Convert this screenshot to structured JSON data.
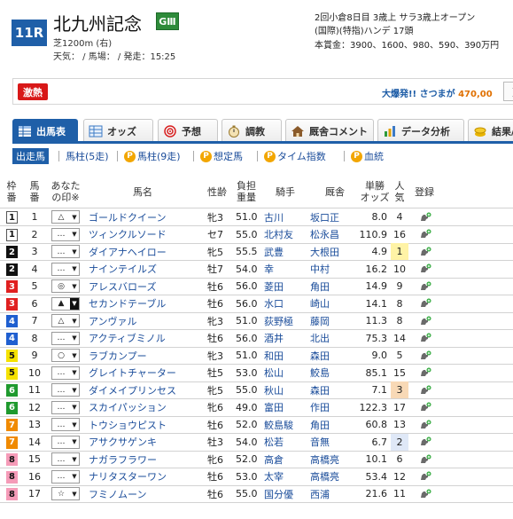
{
  "race": {
    "number": "11R",
    "title": "北九州記念",
    "grade": "GⅢ",
    "course": "芝1200m (右)",
    "conditions": "天気： / 馬場： / 発走：15:25",
    "info1": "2回小倉8日目 3歳上 サラ3歳上オープン",
    "info2": "(国際)(特指)ハンデ 17頭",
    "info3": "本賞金：3900、1600、980、590、390万円"
  },
  "promo": {
    "badge": "激熱",
    "text": "大爆発!! さつまが",
    "price": "470,00",
    "next": "＞"
  },
  "tabs": [
    {
      "label": "出馬表",
      "icon": "table-icon"
    },
    {
      "label": "オッズ",
      "icon": "chart-icon"
    },
    {
      "label": "予想",
      "icon": "target-icon"
    },
    {
      "label": "調教",
      "icon": "stopwatch-icon"
    },
    {
      "label": "厩舎コメント",
      "icon": "house-icon"
    },
    {
      "label": "データ分析",
      "icon": "bar-chart-icon"
    },
    {
      "label": "結果/",
      "icon": "coin-icon"
    }
  ],
  "subnav": [
    {
      "label": "出走馬",
      "premium": false
    },
    {
      "label": "馬柱(5走)",
      "premium": false
    },
    {
      "label": "馬柱(9走)",
      "premium": true
    },
    {
      "label": "想定馬",
      "premium": true
    },
    {
      "label": "タイム指数",
      "premium": true
    },
    {
      "label": "血統",
      "premium": true
    }
  ],
  "headers": {
    "waku": "枠\n番",
    "uma": "馬\n番",
    "mark": "あなた\nの印※",
    "name": "馬名",
    "sex": "性齢",
    "weight": "負担\n重量",
    "jockey": "騎手",
    "trainer": "厩舎",
    "odds": "単勝\nオッズ",
    "pop": "人\n気",
    "reg": "登録"
  },
  "colors": {
    "accent": "#1f5fa8",
    "waku": [
      "#ffffff",
      "#111111",
      "#e02020",
      "#1f5fd0",
      "#f5e200",
      "#1f9a2e",
      "#f08a00",
      "#f59bb8"
    ],
    "wakuText": [
      "#111111",
      "#ffffff",
      "#ffffff",
      "#ffffff",
      "#111111",
      "#ffffff",
      "#ffffff",
      "#111111"
    ]
  },
  "rows": [
    {
      "waku": "1",
      "uma": "1",
      "mark": "△",
      "name": "ゴールドクイーン",
      "sex": "牝3",
      "weight": "51.0",
      "jockey": "古川",
      "trainer": "坂口正",
      "odds": "8.0",
      "pop": "4"
    },
    {
      "waku": "1",
      "uma": "2",
      "mark": "…",
      "name": "ツィンクルソード",
      "sex": "セ7",
      "weight": "55.0",
      "jockey": "北村友",
      "trainer": "松永昌",
      "odds": "110.9",
      "pop": "16"
    },
    {
      "waku": "2",
      "uma": "3",
      "mark": "…",
      "name": "ダイアナヘイロー",
      "sex": "牝5",
      "weight": "55.5",
      "jockey": "武豊",
      "trainer": "大根田",
      "odds": "4.9",
      "pop": "1"
    },
    {
      "waku": "2",
      "uma": "4",
      "mark": "…",
      "name": "ナインテイルズ",
      "sex": "牡7",
      "weight": "54.0",
      "jockey": "幸",
      "trainer": "中村",
      "odds": "16.2",
      "pop": "10"
    },
    {
      "waku": "3",
      "uma": "5",
      "mark": "◎",
      "name": "アレスバローズ",
      "sex": "牡6",
      "weight": "56.0",
      "jockey": "菱田",
      "trainer": "角田",
      "odds": "14.9",
      "pop": "9"
    },
    {
      "waku": "3",
      "uma": "6",
      "mark": "▲",
      "name": "セカンドテーブル",
      "sex": "牡6",
      "weight": "56.0",
      "jockey": "水口",
      "trainer": "崎山",
      "odds": "14.1",
      "pop": "8"
    },
    {
      "waku": "4",
      "uma": "7",
      "mark": "△",
      "name": "アンヴァル",
      "sex": "牝3",
      "weight": "51.0",
      "jockey": "荻野極",
      "trainer": "藤岡",
      "odds": "11.3",
      "pop": "8"
    },
    {
      "waku": "4",
      "uma": "8",
      "mark": "…",
      "name": "アクティブミノル",
      "sex": "牡6",
      "weight": "56.0",
      "jockey": "酒井",
      "trainer": "北出",
      "odds": "75.3",
      "pop": "14"
    },
    {
      "waku": "5",
      "uma": "9",
      "mark": "○",
      "name": "ラブカンプー",
      "sex": "牝3",
      "weight": "51.0",
      "jockey": "和田",
      "trainer": "森田",
      "odds": "9.0",
      "pop": "5"
    },
    {
      "waku": "5",
      "uma": "10",
      "mark": "…",
      "name": "グレイトチャーター",
      "sex": "牡5",
      "weight": "53.0",
      "jockey": "松山",
      "trainer": "鮫島",
      "odds": "85.1",
      "pop": "15"
    },
    {
      "waku": "6",
      "uma": "11",
      "mark": "…",
      "name": "ダイメイプリンセス",
      "sex": "牝5",
      "weight": "55.0",
      "jockey": "秋山",
      "trainer": "森田",
      "odds": "7.1",
      "pop": "3"
    },
    {
      "waku": "6",
      "uma": "12",
      "mark": "…",
      "name": "スカイパッション",
      "sex": "牝6",
      "weight": "49.0",
      "jockey": "富田",
      "trainer": "作田",
      "odds": "122.3",
      "pop": "17"
    },
    {
      "waku": "7",
      "uma": "13",
      "mark": "…",
      "name": "トウショウピスト",
      "sex": "牡6",
      "weight": "52.0",
      "jockey": "鮫島駿",
      "trainer": "角田",
      "odds": "60.8",
      "pop": "13"
    },
    {
      "waku": "7",
      "uma": "14",
      "mark": "…",
      "name": "アサクサゲンキ",
      "sex": "牡3",
      "weight": "54.0",
      "jockey": "松若",
      "trainer": "音無",
      "odds": "6.7",
      "pop": "2"
    },
    {
      "waku": "8",
      "uma": "15",
      "mark": "…",
      "name": "ナガラフラワー",
      "sex": "牝6",
      "weight": "52.0",
      "jockey": "高倉",
      "trainer": "高橋亮",
      "odds": "10.1",
      "pop": "6"
    },
    {
      "waku": "8",
      "uma": "16",
      "mark": "…",
      "name": "ナリタスターワン",
      "sex": "牡6",
      "weight": "53.0",
      "jockey": "太宰",
      "trainer": "高橋亮",
      "odds": "53.4",
      "pop": "12"
    },
    {
      "waku": "8",
      "uma": "17",
      "mark": "☆",
      "name": "フミノムーン",
      "sex": "牡6",
      "weight": "55.0",
      "jockey": "国分優",
      "trainer": "西浦",
      "odds": "21.6",
      "pop": "11"
    }
  ]
}
